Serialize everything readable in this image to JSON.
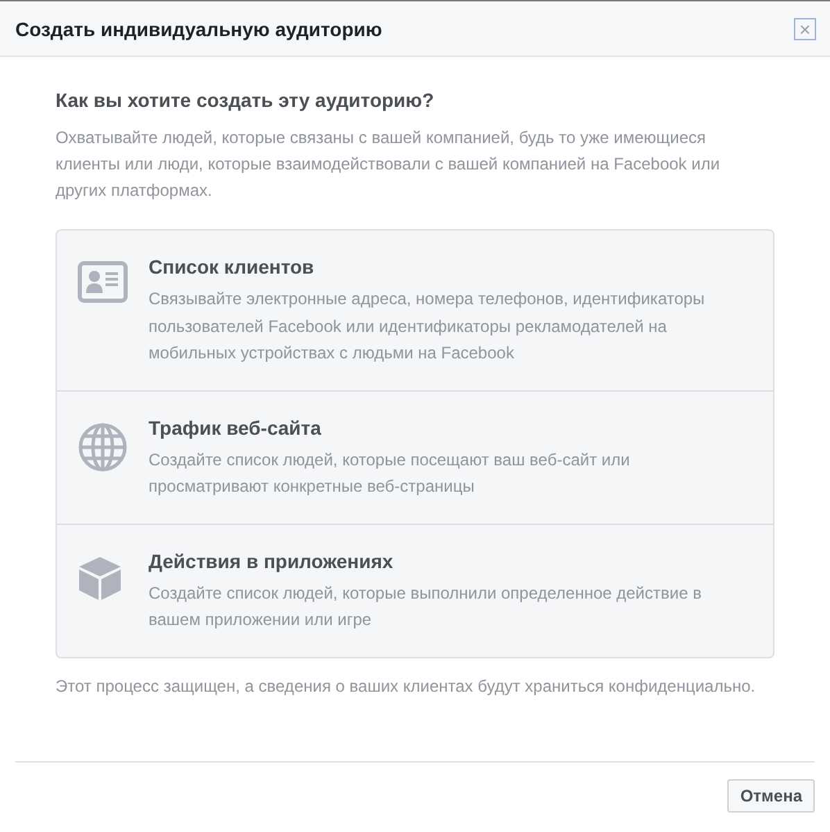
{
  "window": {
    "title": "Создать индивидуальную аудиторию",
    "close": "×"
  },
  "heading": "Как вы хотите создать эту аудиторию?",
  "intro": "Охватывайте людей, которые связаны с вашей компанией, будь то уже имеющиеся клиенты или люди, которые взаимодействовали с вашей компанией на Facebook или других платформах.",
  "options": [
    {
      "kind": "customers",
      "title": "Список клиентов",
      "description": "Связывайте электронные адреса, номера телефонов, идентификаторы пользователей Facebook или идентификаторы рекламодателей на мобильных устройствах с людьми на Facebook"
    },
    {
      "kind": "website",
      "title": "Трафик веб-сайта",
      "description": "Создайте список людей, которые посещают ваш веб-сайт или просматривают конкретные веб-страницы"
    },
    {
      "kind": "app",
      "title": "Действия в приложениях",
      "description": "Создайте список людей, которые выполнили определенное действие в вашем приложении или игре"
    }
  ],
  "note": "Этот процесс защищен, а сведения о ваших клиентах будут храниться конфиденциально.",
  "buttons": [
    "Отмена"
  ]
}
